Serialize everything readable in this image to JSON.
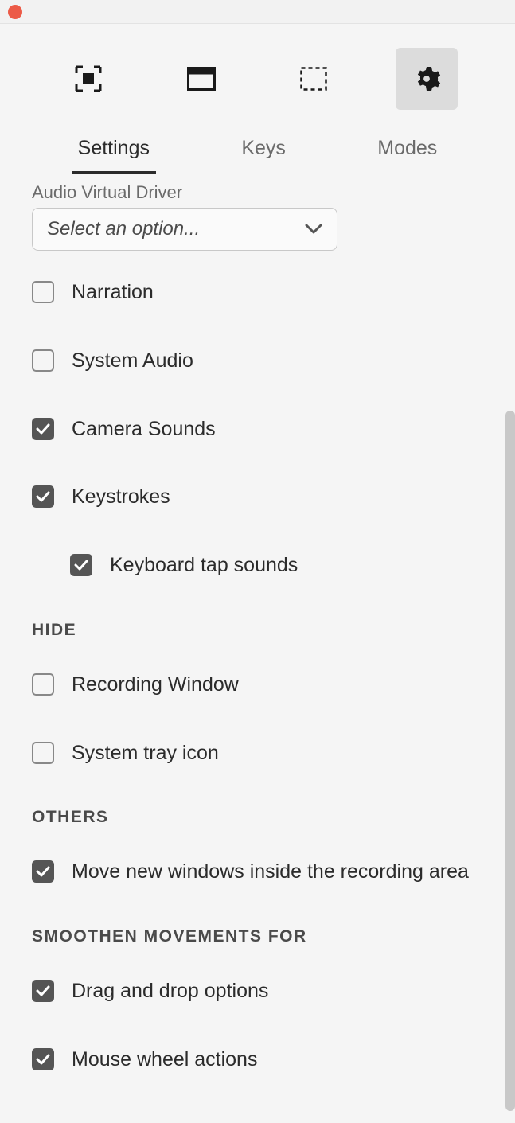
{
  "titlebar": {
    "close": "close"
  },
  "toolbar": {
    "items": [
      {
        "name": "fullscreen-icon",
        "active": false
      },
      {
        "name": "window-icon",
        "active": false
      },
      {
        "name": "region-icon",
        "active": false
      },
      {
        "name": "gear-icon",
        "active": true
      }
    ]
  },
  "tabs": [
    {
      "label": "Settings",
      "active": true
    },
    {
      "label": "Keys",
      "active": false
    },
    {
      "label": "Modes",
      "active": false
    }
  ],
  "audio_driver": {
    "label": "Audio Virtual Driver",
    "placeholder": "Select an option..."
  },
  "options": {
    "narration": {
      "label": "Narration",
      "checked": false
    },
    "system_audio": {
      "label": "System Audio",
      "checked": false
    },
    "camera_sounds": {
      "label": "Camera Sounds",
      "checked": true
    },
    "keystrokes": {
      "label": "Keystrokes",
      "checked": true
    },
    "tap_sounds": {
      "label": "Keyboard tap sounds",
      "checked": true
    }
  },
  "hide": {
    "header": "HIDE",
    "recording_window": {
      "label": "Recording Window",
      "checked": false
    },
    "tray_icon": {
      "label": "System tray icon",
      "checked": false
    }
  },
  "others": {
    "header": "OTHERS",
    "move_windows": {
      "label": "Move new windows inside the recording area",
      "checked": true
    }
  },
  "smoothen": {
    "header": "SMOOTHEN MOVEMENTS FOR",
    "drag_drop": {
      "label": "Drag and drop options",
      "checked": true
    },
    "mouse_wheel": {
      "label": "Mouse wheel actions",
      "checked": true
    }
  }
}
